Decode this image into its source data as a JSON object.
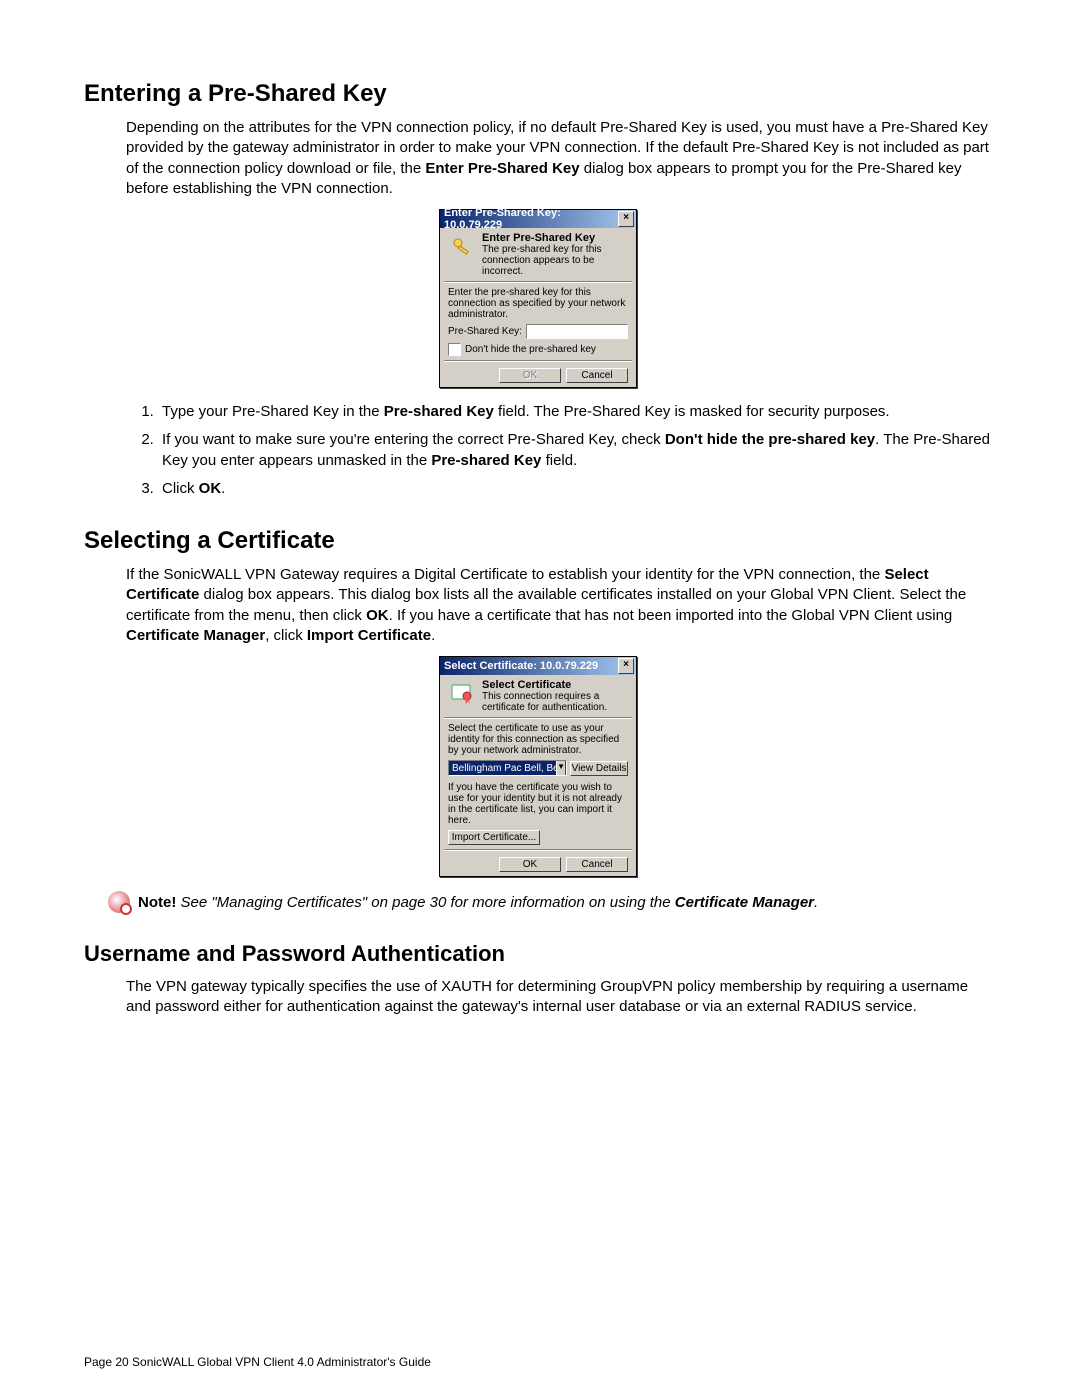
{
  "footer": "Page 20 SonicWALL Global VPN Client 4.0 Administrator's Guide",
  "sec1": {
    "title": "Entering a Pre-Shared Key",
    "para_parts": {
      "p1a": "Depending on the attributes for the VPN connection policy, if no default Pre-Shared Key is used, you must have a Pre-Shared Key provided by the gateway administrator in order to make your VPN connection. If the default Pre-Shared Key is not included as part of the connection policy download or file, the ",
      "p1b": "Enter Pre-Shared Key",
      "p1c": " dialog box appears to prompt you for the Pre-Shared key before establishing the VPN connection."
    },
    "dlg": {
      "title": "Enter Pre-Shared Key: 10.0.79.229",
      "head_bold": "Enter Pre-Shared Key",
      "head_sub": "The pre-shared key for this connection appears to be incorrect.",
      "instr": "Enter the pre-shared key for this connection as specified by your network administrator.",
      "field_label": "Pre-Shared Key:",
      "checkbox_label": "Don't hide the pre-shared key",
      "btn_ok": "OK",
      "btn_cancel": "Cancel"
    },
    "steps": {
      "s1a": "Type your Pre-Shared Key in the ",
      "s1b": "Pre-shared Key",
      "s1c": " field. The Pre-Shared Key is masked for security purposes.",
      "s2a": "If you want to make sure you're entering the correct Pre-Shared Key, check ",
      "s2b": "Don't hide the pre-shared key",
      "s2c": ". The Pre-Shared Key you enter appears unmasked in the ",
      "s2d": "Pre-shared Key",
      "s2e": " field.",
      "s3a": "Click ",
      "s3b": "OK",
      "s3c": "."
    }
  },
  "sec2": {
    "title": "Selecting a Certificate",
    "para_parts": {
      "p1a": "If the SonicWALL VPN Gateway requires a Digital Certificate to establish your identity for the VPN connection, the ",
      "p1b": "Select Certificate",
      "p1c": " dialog box appears. This dialog box lists all the available certificates installed on your Global VPN Client. Select the certificate from the menu, then click ",
      "p1d": "OK",
      "p1e": ". If you have a certificate that has not been imported into the Global VPN Client using ",
      "p1f": "Certificate Manager",
      "p1g": ", click ",
      "p1h": "Import Certificate",
      "p1i": "."
    },
    "dlg": {
      "title": "Select Certificate: 10.0.79.229",
      "head_bold": "Select Certificate",
      "head_sub": "This connection requires a certificate for authentication.",
      "instr": "Select the certificate to use as your identity for this connection as specified by your network administrator.",
      "selected": "Bellingham Pac Bell, Bellingham Pac Bell C",
      "btn_view": "View Details",
      "instr2": "If you have the certificate you wish to use for your identity but it is not already in the certificate list, you can import it here.",
      "btn_import": "Import Certificate...",
      "btn_ok": "OK",
      "btn_cancel": "Cancel"
    },
    "note": {
      "bold": "Note!",
      "ital_a": " See \"Managing Certificates\" on page 30 for more information on using the ",
      "ital_b": "Certificate Manager",
      "ital_c": "."
    }
  },
  "sec3": {
    "title": "Username and Password Authentication",
    "para": "The VPN gateway typically specifies the use of XAUTH for determining GroupVPN policy membership by requiring a username and password either for authentication against the gateway's internal user database or via an external RADIUS service."
  }
}
